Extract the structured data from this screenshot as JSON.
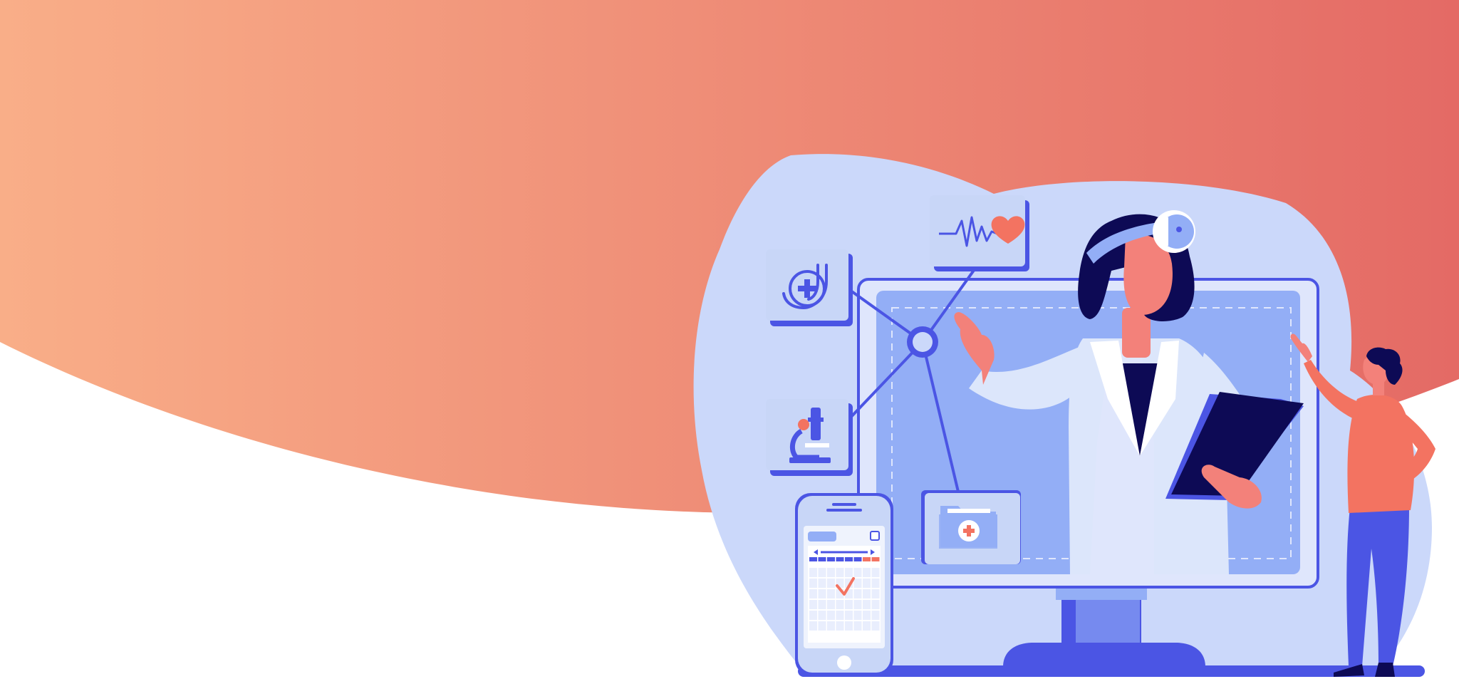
{
  "colors": {
    "banner_start": "#F9AE88",
    "banner_end": "#E46A65",
    "blob": "#CBD8FA",
    "monitor_frame": "#DFE6FC",
    "screen": "#93AEF6",
    "primary_blue": "#4B55E4",
    "dark_navy": "#0D0A55",
    "coral": "#F37361",
    "skin": "#F3817A",
    "coat": "#DCE6FB",
    "card": "#C8D6F7",
    "white": "#FFFFFF"
  },
  "icons": [
    "stethoscope-icon",
    "heartbeat-icon",
    "microscope-icon",
    "medical-folder-icon",
    "network-hub-icon",
    "calendar-app-icon",
    "checkmark-icon"
  ],
  "calendar": {
    "rows": 7,
    "cols": 8,
    "checked": true
  }
}
